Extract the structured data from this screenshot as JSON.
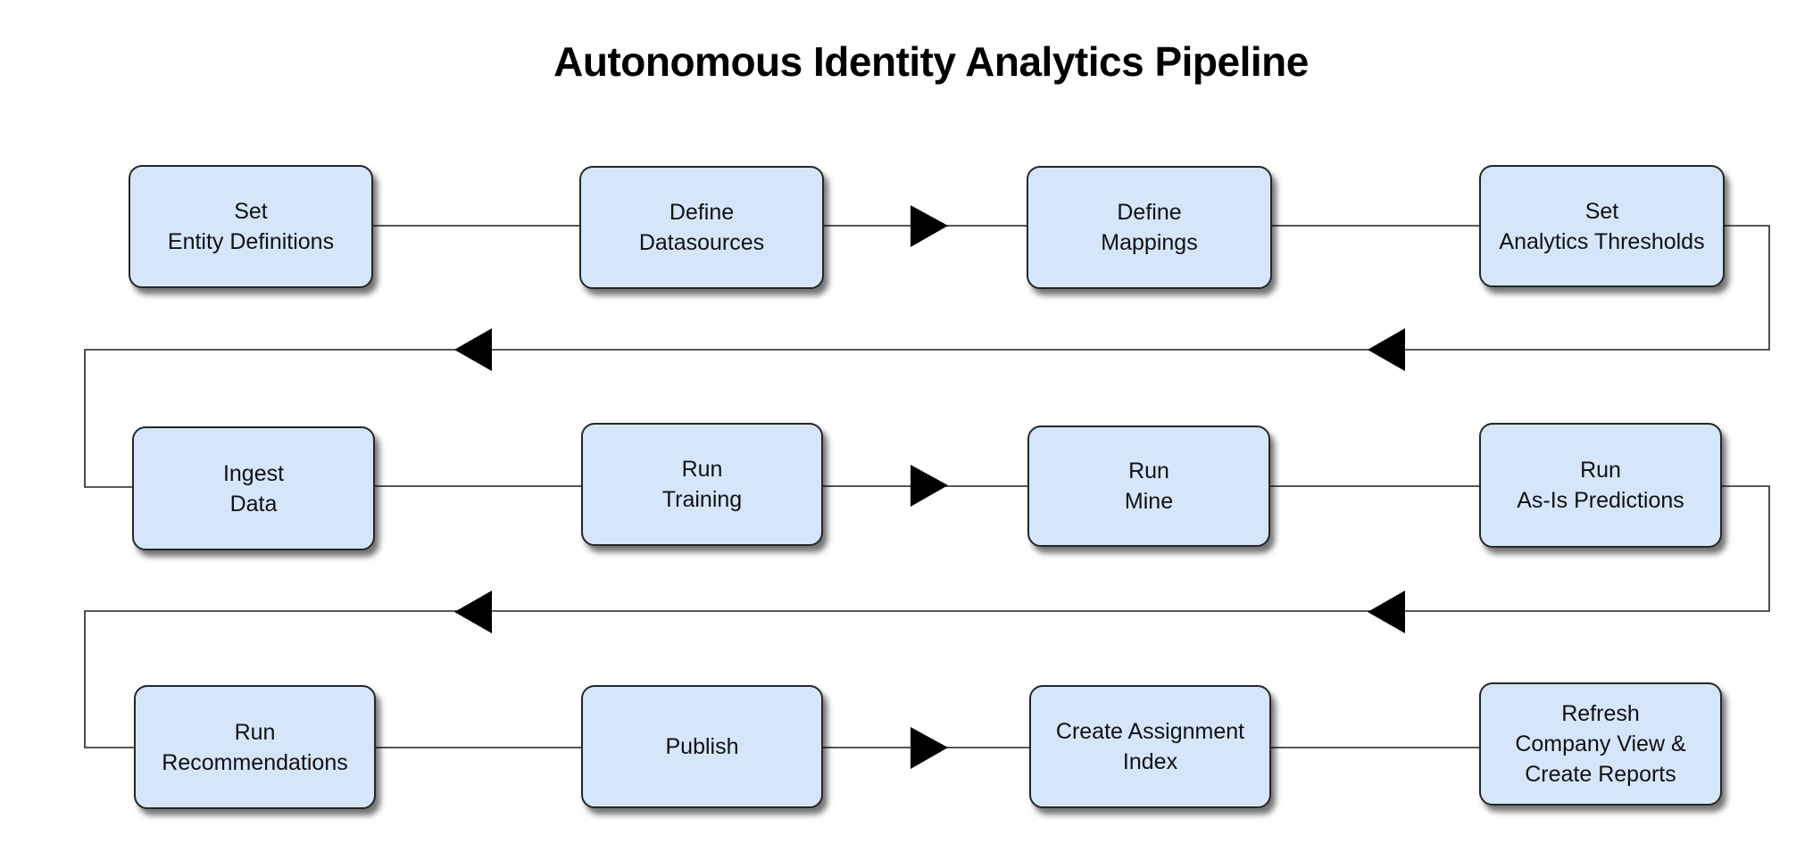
{
  "title": "Autonomous Identity Analytics Pipeline",
  "colors": {
    "node_fill": "#d5e6fb",
    "node_border": "#262626",
    "connector": "#444444",
    "arrow": "#000000"
  },
  "rows": [
    {
      "direction": "left-to-right",
      "steps": [
        {
          "id": "set-entity-definitions",
          "label": "Set\nEntity Definitions"
        },
        {
          "id": "define-datasources",
          "label": "Define\nDatasources"
        },
        {
          "id": "define-mappings",
          "label": "Define\nMappings"
        },
        {
          "id": "set-analytics-thresholds",
          "label": "Set\nAnalytics Thresholds"
        }
      ]
    },
    {
      "direction": "left-to-right",
      "steps": [
        {
          "id": "ingest-data",
          "label": "Ingest\nData"
        },
        {
          "id": "run-training",
          "label": "Run\nTraining"
        },
        {
          "id": "run-mine",
          "label": "Run\nMine"
        },
        {
          "id": "run-as-is-predictions",
          "label": "Run\nAs-Is Predictions"
        }
      ]
    },
    {
      "direction": "left-to-right",
      "steps": [
        {
          "id": "run-recommendations",
          "label": "Run\nRecommendations"
        },
        {
          "id": "publish",
          "label": "Publish"
        },
        {
          "id": "create-assignment-index",
          "label": "Create Assignment\nIndex"
        },
        {
          "id": "refresh-company-view-create-reports",
          "label": "Refresh\nCompany View &\nCreate Reports"
        }
      ]
    }
  ],
  "edges": [
    {
      "from": "set-entity-definitions",
      "to": "define-datasources"
    },
    {
      "from": "define-datasources",
      "to": "define-mappings",
      "arrow": "right"
    },
    {
      "from": "define-mappings",
      "to": "set-analytics-thresholds"
    },
    {
      "from": "set-analytics-thresholds",
      "to": "ingest-data",
      "arrow": "left",
      "wrap": true
    },
    {
      "from": "ingest-data",
      "to": "run-training"
    },
    {
      "from": "run-training",
      "to": "run-mine",
      "arrow": "right"
    },
    {
      "from": "run-mine",
      "to": "run-as-is-predictions"
    },
    {
      "from": "run-as-is-predictions",
      "to": "run-recommendations",
      "arrow": "left",
      "wrap": true
    },
    {
      "from": "run-recommendations",
      "to": "publish"
    },
    {
      "from": "publish",
      "to": "create-assignment-index",
      "arrow": "right"
    },
    {
      "from": "create-assignment-index",
      "to": "refresh-company-view-create-reports"
    }
  ]
}
